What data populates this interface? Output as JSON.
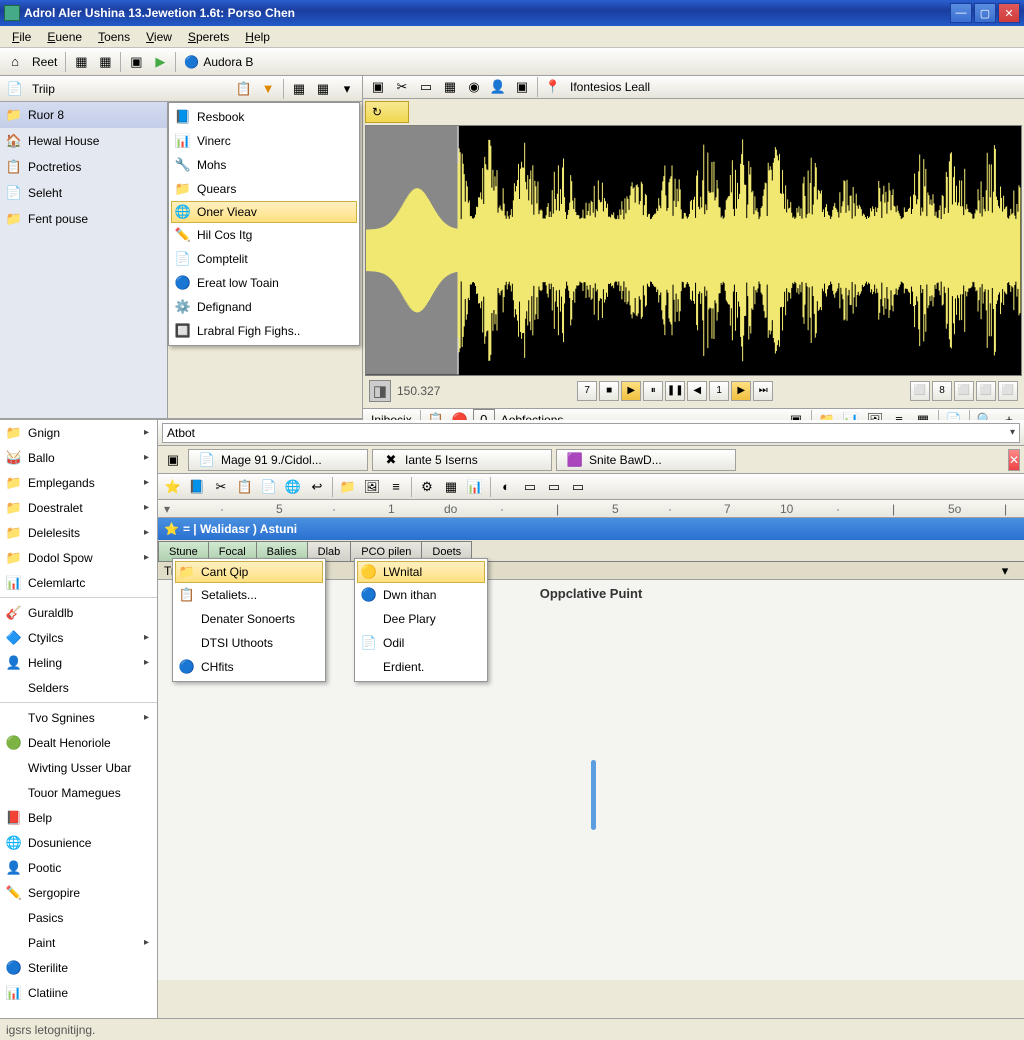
{
  "title": "Adrol Aler Ushina 13.Jewetion 1.6t: Porso Chen",
  "menubar": [
    "File",
    "Euene",
    "Toens",
    "View",
    "Sperets",
    "Help"
  ],
  "toolbar1": {
    "reet": "Reet",
    "audora": "Audora B"
  },
  "toolbar_right": {
    "inbook": "Inibocix",
    "aobfections": "Aobfections",
    "intensios": "Ifontesios Leall"
  },
  "nav_toolbar_item": "Triip",
  "nav_items": [
    {
      "label": "Ruor 8",
      "icon": "📁",
      "selected": true
    },
    {
      "label": "Hewal House",
      "icon": "🏠"
    },
    {
      "label": "Poctretios",
      "icon": "📋"
    },
    {
      "label": "Seleht",
      "icon": "📄"
    },
    {
      "label": "Fent pouse",
      "icon": "📁"
    }
  ],
  "popup1": [
    {
      "label": "Resbook",
      "icon": "📘"
    },
    {
      "label": "Vinerc",
      "icon": "📊"
    },
    {
      "label": "Mohs",
      "icon": "🔧"
    },
    {
      "label": "Quears",
      "icon": "📁"
    },
    {
      "label": "Oner Vieav",
      "icon": "🌐",
      "hover": true
    },
    {
      "label": "Hil Cos Itg",
      "icon": "✏️"
    },
    {
      "label": "Comptelit",
      "icon": "📄"
    },
    {
      "label": "Ereat low Toain",
      "icon": "🔵"
    },
    {
      "label": "Defignand",
      "icon": "⚙️"
    },
    {
      "label": "Lrabral Figh Fighs..",
      "icon": "🔲"
    }
  ],
  "readout_value": "150.327",
  "transport_btns": [
    "7",
    "■",
    "▶",
    "⏸",
    "❚❚",
    "◀",
    "1",
    "▶",
    "⏭"
  ],
  "transport_right": [
    "⬜",
    "8",
    "⬜",
    "⬜",
    "⬜"
  ],
  "address_value": "Atbot",
  "file_tabs": [
    {
      "label": "Mage 91 9./Cidol...",
      "icon": "📄"
    },
    {
      "label": "Iante 5 Iserns",
      "icon": "✖"
    },
    {
      "label": "Snite BawD...",
      "icon": "🟪"
    }
  ],
  "ruler_marks": [
    "▾",
    "·",
    "5",
    "·",
    "1",
    "do",
    "·",
    "|",
    "5",
    "·",
    "7",
    "10",
    "·",
    "|",
    "5o",
    "|"
  ],
  "doc_title": "= | Walidasr ) Astuni",
  "sheet_tabs": [
    "Stune",
    "Focal",
    "Balies",
    "Dlab",
    "PCO pilen",
    "Doets"
  ],
  "sheet_sub": "Tri   loallier",
  "popup2": [
    {
      "label": "Cant Qip",
      "icon": "📁",
      "hover": true
    },
    {
      "label": "Setaliets...",
      "icon": "📋"
    },
    {
      "label": "Denater Sonoerts",
      "icon": ""
    },
    {
      "label": "DTSI Uthoots",
      "icon": ""
    },
    {
      "label": "CHfits",
      "icon": "🔵"
    }
  ],
  "popup3": [
    {
      "label": "LWnital",
      "icon": "🟡",
      "hover": true
    },
    {
      "label": "Dwn ithan",
      "icon": "🔵"
    },
    {
      "label": "Dee Plary",
      "icon": ""
    },
    {
      "label": "Odil",
      "icon": "📄"
    },
    {
      "label": "Erdient.",
      "icon": ""
    }
  ],
  "opp_label": "Oppclative Puint",
  "categories": [
    {
      "label": "Gnign",
      "icon": "📁",
      "arrow": true
    },
    {
      "label": "Ballo",
      "icon": "🥁",
      "arrow": true
    },
    {
      "label": "Emplegands",
      "icon": "📁",
      "arrow": true
    },
    {
      "label": "Doestralet",
      "icon": "📁",
      "arrow": true
    },
    {
      "label": "Delelesits",
      "icon": "📁",
      "arrow": true
    },
    {
      "label": "Dodol Spow",
      "icon": "📁",
      "arrow": true
    },
    {
      "label": "Celemlartc",
      "icon": "📊"
    },
    {
      "sep": true
    },
    {
      "label": "Guraldlb",
      "icon": "🎸"
    },
    {
      "label": "Ctyilcs",
      "icon": "🔷",
      "arrow": true
    },
    {
      "label": "Heling",
      "icon": "👤",
      "arrow": true
    },
    {
      "label": "Selders",
      "icon": ""
    },
    {
      "sep": true
    },
    {
      "label": "Tvo Sgnines",
      "icon": "",
      "arrow": true
    },
    {
      "label": "Dealt Henoriole",
      "icon": "🟢"
    },
    {
      "label": "Wivting Usser Ubar",
      "icon": ""
    },
    {
      "label": "Touor Mamegues",
      "icon": ""
    },
    {
      "label": "Belp",
      "icon": "📕"
    },
    {
      "label": "Dosunience",
      "icon": "🌐"
    },
    {
      "label": "Pootic",
      "icon": "👤"
    },
    {
      "label": "Sergopire",
      "icon": "✏️"
    },
    {
      "label": "Pasics",
      "icon": ""
    },
    {
      "label": "Paint",
      "icon": "",
      "arrow": true
    },
    {
      "label": "Sterilite",
      "icon": "🔵"
    },
    {
      "label": "Clatiine",
      "icon": "📊"
    }
  ],
  "status": "igsrs letognitijng."
}
